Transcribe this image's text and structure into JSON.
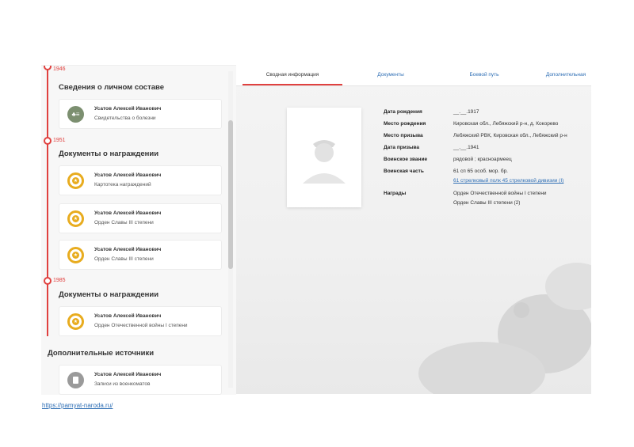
{
  "left": {
    "top_year": "1946",
    "sections": [
      {
        "title": "Сведения о личном составе",
        "cards": [
          {
            "name": "Усатов Алексей Иванович",
            "desc": "Свидетельства о болезни",
            "icon": "medical-record-icon"
          }
        ]
      },
      {
        "year": "1951",
        "title": "Документы о награждении",
        "cards": [
          {
            "name": "Усатов Алексей Иванович",
            "desc": "Картотека награждений",
            "icon": "award-medal-icon"
          },
          {
            "name": "Усатов Алексей Иванович",
            "desc": "Орден Славы III степени",
            "icon": "award-medal-icon"
          },
          {
            "name": "Усатов Алексей Иванович",
            "desc": "Орден Славы III степени",
            "icon": "award-medal-icon"
          }
        ]
      },
      {
        "year": "1985",
        "title": "Документы о награждении",
        "cards": [
          {
            "name": "Усатов Алексей Иванович",
            "desc": "Орден Отечественной войны I степени",
            "icon": "award-medal-icon"
          }
        ]
      },
      {
        "title": "Дополнительные источники",
        "cards": [
          {
            "name": "Усатов Алексей Иванович",
            "desc": "Записи из военкоматов",
            "icon": "document-icon"
          }
        ]
      }
    ]
  },
  "tabs": [
    "Сводная информация",
    "Документы",
    "Боевой путь",
    "Дополнительная"
  ],
  "info": {
    "rows": [
      {
        "label": "Дата рождения",
        "value": "__.__.1917"
      },
      {
        "label": "Место рождения",
        "value": "Кировская обл., Лебяжский р-н, д. Кокорево"
      },
      {
        "label": "Место призыва",
        "value": "Лебяжский РВК, Кировская обл., Лебяжский р-н"
      },
      {
        "label": "Дата призыва",
        "value": "__.__.1941"
      },
      {
        "label": "Воинское звание",
        "value": "рядовой ; красноармеец"
      },
      {
        "label": "Воинская часть",
        "value": "61 сп 65 особ. мор. бр.",
        "link": "61 стрелковый полк 45 стрелковой дивизии (I)"
      },
      {
        "label": "Награды",
        "value": "Орден Отечественной войны I степени",
        "value2": "Орден Славы III степени (2)"
      }
    ]
  },
  "source_link": "https://pamyat-naroda.ru/",
  "colors": {
    "accent": "#e0413f",
    "link": "#2f6fb5",
    "medal": "#e8ac1f"
  }
}
